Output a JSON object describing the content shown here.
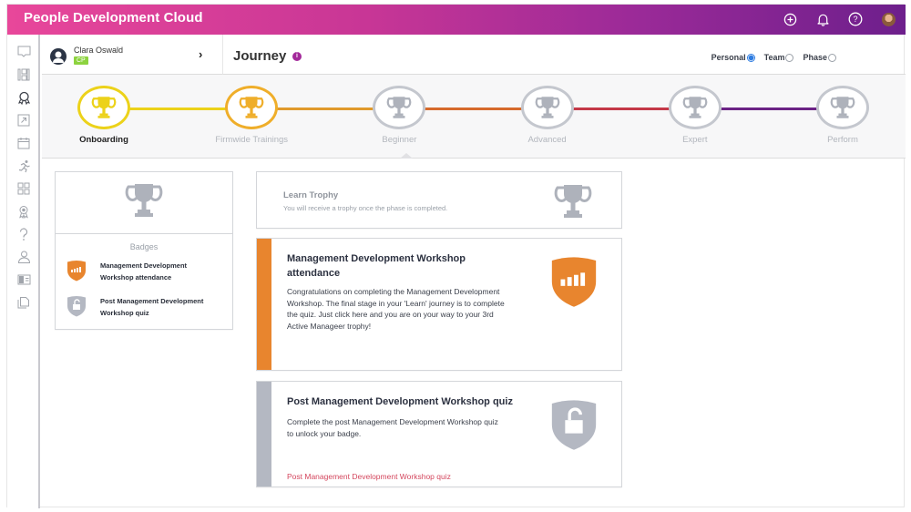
{
  "app": {
    "title": "People Development Cloud",
    "gradient": [
      "#e8479a",
      "#6d1f8c"
    ],
    "top_icons": [
      "plus-circle-icon",
      "bell-icon",
      "help-icon",
      "user-avatar-icon"
    ]
  },
  "sidebar": {
    "items": [
      {
        "name": "chat-icon"
      },
      {
        "name": "layout-icon"
      },
      {
        "name": "award-icon",
        "active": true
      },
      {
        "name": "external-link-icon"
      },
      {
        "name": "calendar-icon"
      },
      {
        "name": "runner-icon"
      },
      {
        "name": "grid-icon"
      },
      {
        "name": "badge-ribbon-icon"
      },
      {
        "name": "question-icon"
      },
      {
        "name": "person-icon"
      },
      {
        "name": "id-card-icon"
      },
      {
        "name": "copy-icon"
      }
    ]
  },
  "user": {
    "name": "Clara Oswald",
    "badge": "CP",
    "badge_color": "#8dd33f"
  },
  "header": {
    "title": "Journey",
    "info": "i",
    "view_options": [
      {
        "label": "Personal",
        "selected": true
      },
      {
        "label": "Team",
        "selected": false
      },
      {
        "label": "Phase",
        "selected": false
      }
    ]
  },
  "journey": {
    "steps": [
      {
        "label": "Onboarding",
        "status": "active",
        "color": "#ecd21a"
      },
      {
        "label": "Firmwide Trainings",
        "status": "completed",
        "color": "#efae2a"
      },
      {
        "label": "Beginner",
        "status": "locked",
        "color": "#c4c7ce"
      },
      {
        "label": "Advanced",
        "status": "locked",
        "color": "#c4c7ce"
      },
      {
        "label": "Expert",
        "status": "locked",
        "color": "#c4c7ce"
      },
      {
        "label": "Perform",
        "status": "locked",
        "color": "#c4c7ce"
      }
    ],
    "connector_colors": [
      "#ecd21a",
      "#e09a2c",
      "#d66a2c",
      "#c43848",
      "#6b2285"
    ]
  },
  "summary": {
    "badges_title": "Badges",
    "badges": [
      {
        "label": "Management Development Workshop attendance",
        "status": "earned",
        "color": "#e8852e"
      },
      {
        "label": "Post Management Development Workshop quiz",
        "status": "locked",
        "color": "#b4b8c2"
      }
    ]
  },
  "learn_trophy": {
    "title": "Learn Trophy",
    "subtitle": "You will receive a trophy once the phase is completed."
  },
  "tasks": [
    {
      "title": "Management Development Workshop attendance",
      "body": "Congratulations on completing the Management Development Workshop. The final stage in your 'Learn' journey is to complete the quiz. Just click here and you are on your way to your 3rd Active Manageer trophy!",
      "stripe_color": "#e8852e",
      "badge": "signal-bars-shield-icon"
    },
    {
      "title": "Post Management Development Workshop quiz",
      "body": "Complete the post Management Development Workshop quiz to unlock your badge.",
      "link": "Post Management Development Workshop quiz",
      "stripe_color": "#b4b8c2",
      "badge": "unlocked-padlock-shield-icon"
    }
  ]
}
